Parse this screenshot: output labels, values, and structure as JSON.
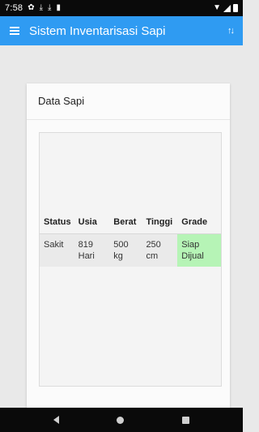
{
  "status_bar": {
    "time": "7:58"
  },
  "app_bar": {
    "title": "Sistem Inventarisasi Sapi",
    "sort_icon_glyph": "↑↓"
  },
  "card": {
    "title": "Data Sapi"
  },
  "table": {
    "headers": [
      "Status",
      "Usia",
      "Berat",
      "Tinggi",
      "Grade"
    ],
    "rows": [
      {
        "status": "Sakit",
        "usia": "819 Hari",
        "berat": "500 kg",
        "tinggi": "250 cm",
        "grade": "Siap Dijual"
      }
    ]
  },
  "colors": {
    "app_bar": "#2f9bf2",
    "grade_highlight": "#b6f4b6",
    "status_bar": "#0a0a0a"
  },
  "icons": {
    "status_bar": [
      "gear-icon",
      "download-icon",
      "download-icon",
      "sd-card-icon",
      "wifi-icon",
      "signal-icon",
      "battery-icon"
    ],
    "app_bar": [
      "menu-icon",
      "sort-icon"
    ],
    "nav_bar": [
      "back-icon",
      "home-icon",
      "recent-apps-icon"
    ]
  }
}
